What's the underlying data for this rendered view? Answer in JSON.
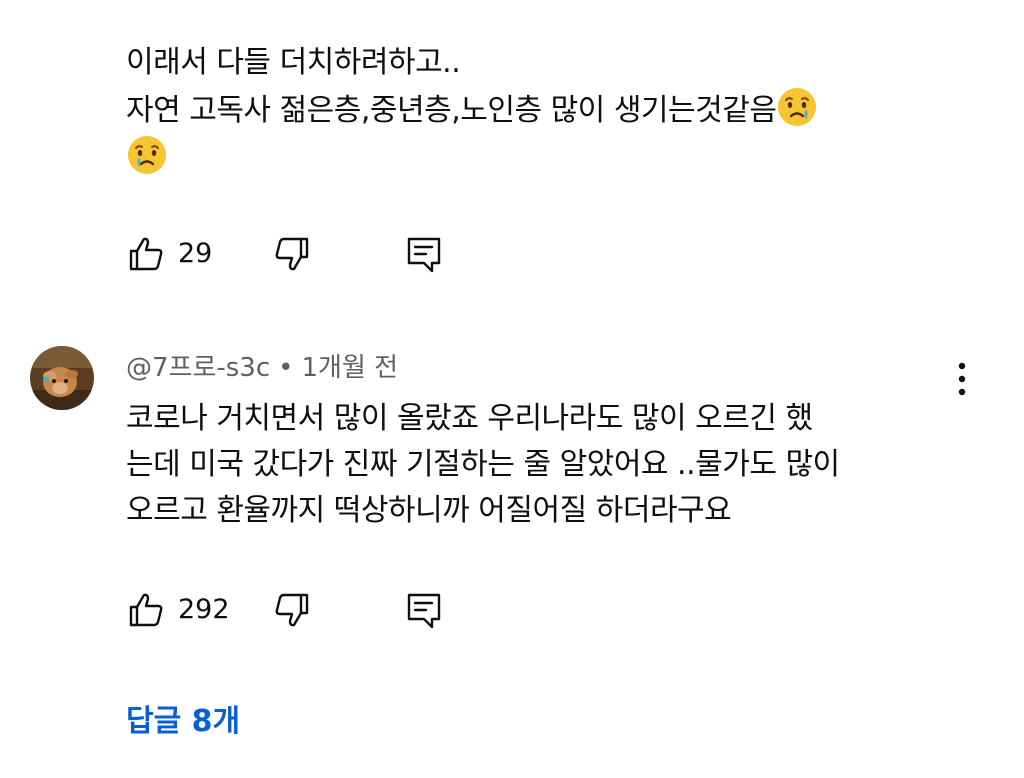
{
  "comment1": {
    "text_lines": [
      "이래서 다들 더치하려하고..",
      "자연 고독사 젊은층,중년층,노인층 많이 생기는것같음"
    ],
    "emoji": "crying-face",
    "likes": "29"
  },
  "comment2": {
    "author": "@7프로-s3c",
    "separator": "•",
    "time": "1개월 전",
    "text": "코로나 거치면서 많이 올랐죠 우리나라도 많이 오르긴 했\n는데 미국 갔다가 진짜 기절하는 줄 알았어요 ..물가도 많이\n오르고 환율까지 떡상하니까 어질어질 하더라구요",
    "likes": "292"
  },
  "replies": {
    "label": "답글 8개"
  },
  "colors": {
    "link": "#065fd4",
    "meta": "#606060",
    "text": "#0f0f0f",
    "emoji_face": "#f7c531",
    "emoji_tear": "#4aa8e8"
  },
  "icons": [
    "thumbs-up-icon",
    "thumbs-down-icon",
    "reply-icon",
    "more-vert-icon",
    "crying-face-emoji"
  ]
}
